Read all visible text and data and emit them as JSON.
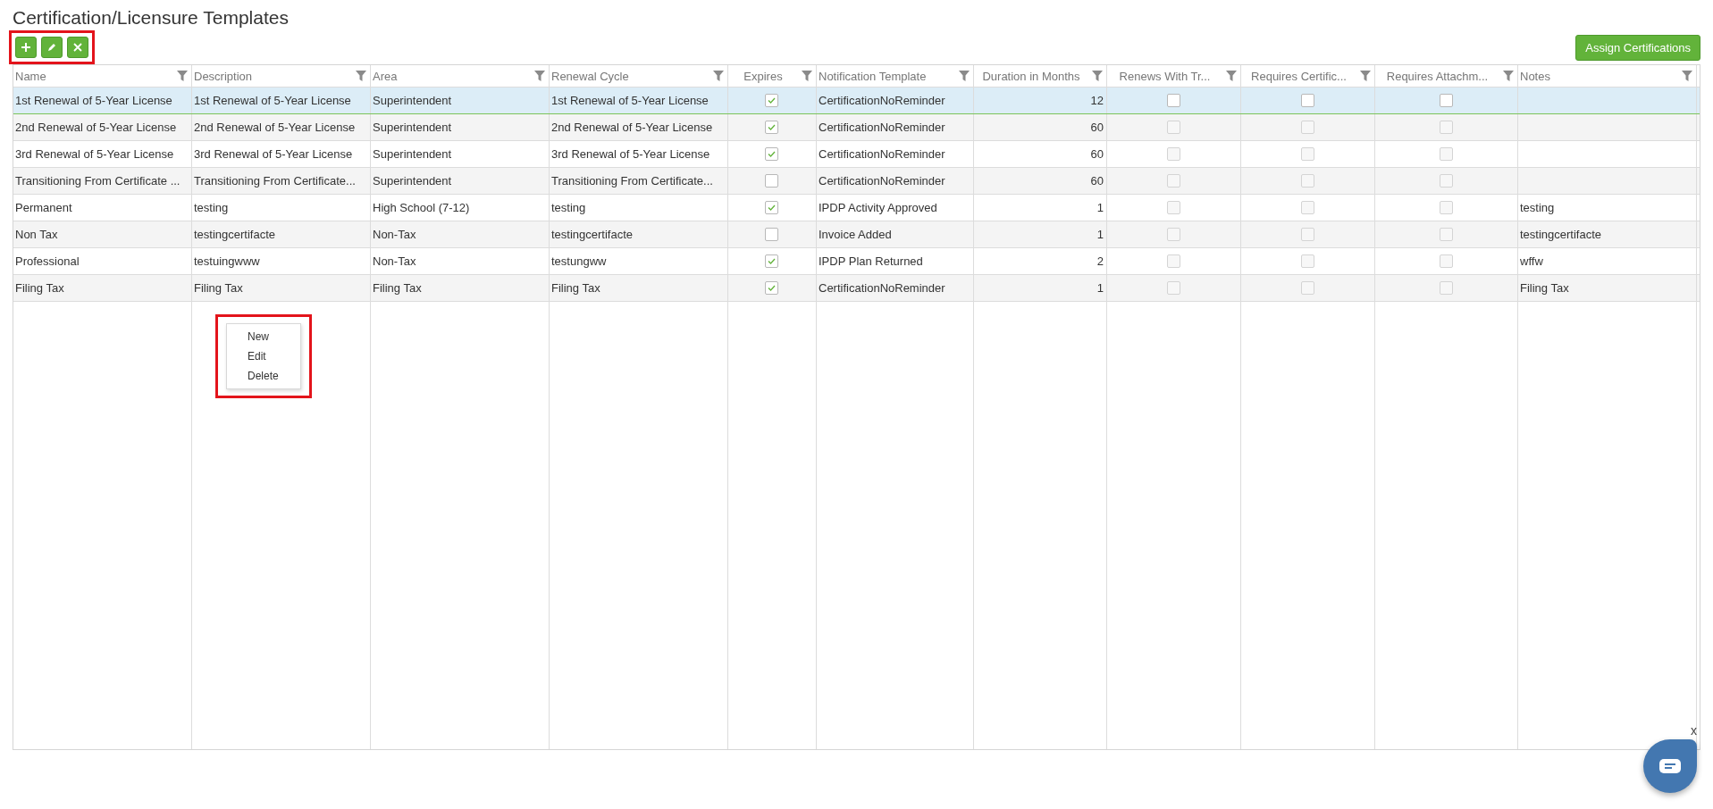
{
  "title": "Certification/Licensure Templates",
  "toolbar": [
    {
      "kind": "add"
    },
    {
      "kind": "edit"
    },
    {
      "kind": "delete"
    }
  ],
  "assign_button": "Assign Certifications",
  "columns": [
    "Name",
    "Description",
    "Area",
    "Renewal Cycle",
    "Expires",
    "Notification Template",
    "Duration in Months",
    "Renews With Tr...",
    "Requires Certific...",
    "Requires Attachm...",
    "Notes"
  ],
  "rows": [
    {
      "selected": true,
      "name": "1st Renewal of 5-Year License",
      "description": "1st Renewal of 5-Year License",
      "area": "Superintendent",
      "renewal_cycle": "1st Renewal of 5-Year License",
      "expires": true,
      "notification": "CertificationNoReminder",
      "duration": "12",
      "renews": false,
      "requires_certificate": false,
      "requires_attachment": false
    },
    {
      "selected": false,
      "name": "2nd Renewal of 5-Year License",
      "description": "2nd Renewal of 5-Year License",
      "area": "Superintendent",
      "renewal_cycle": "2nd Renewal of 5-Year License",
      "expires": true,
      "notification": "CertificationNoReminder",
      "duration": "60",
      "renews": false,
      "requires_certificate": false,
      "requires_attachment": false
    },
    {
      "selected": false,
      "name": "3rd Renewal of 5-Year License",
      "description": "3rd Renewal of 5-Year License",
      "area": "Superintendent",
      "renewal_cycle": "3rd Renewal of 5-Year License",
      "expires": true,
      "notification": "CertificationNoReminder",
      "duration": "60",
      "renews": false,
      "requires_certificate": false,
      "requires_attachment": false
    },
    {
      "selected": false,
      "name": "Transitioning From Certificate ...",
      "description": "Transitioning From Certificate...",
      "area": "Superintendent",
      "renewal_cycle": "Transitioning From Certificate...",
      "expires": false,
      "notification": "CertificationNoReminder",
      "duration": "60",
      "renews": false,
      "requires_certificate": false,
      "requires_attachment": false
    },
    {
      "selected": false,
      "name": "Permanent",
      "description": "testing",
      "area": "High School (7-12)",
      "renewal_cycle": "testing",
      "expires": true,
      "notification": "IPDP Activity Approved",
      "duration": "1",
      "renews": false,
      "requires_certificate": false,
      "requires_attachment": false,
      "notes": "testing"
    },
    {
      "selected": false,
      "name": "Non Tax",
      "description": "testingcertifacte",
      "area": "Non-Tax",
      "renewal_cycle": "testingcertifacte",
      "expires": false,
      "notification": "Invoice Added",
      "duration": "1",
      "renews": false,
      "requires_certificate": false,
      "requires_attachment": false,
      "notes": "testingcertifacte"
    },
    {
      "selected": false,
      "name": "Professional",
      "description": "testuingwww",
      "area": "Non-Tax",
      "renewal_cycle": "testungww",
      "expires": true,
      "notification": "IPDP Plan Returned",
      "duration": "2",
      "renews": false,
      "requires_certificate": false,
      "requires_attachment": false,
      "notes": "wffw"
    },
    {
      "selected": false,
      "name": "Filing Tax",
      "description": "Filing Tax",
      "area": "Filing Tax",
      "renewal_cycle": "Filing Tax",
      "expires": true,
      "notification": "CertificationNoReminder",
      "duration": "1",
      "renews": false,
      "requires_certificate": false,
      "requires_attachment": false,
      "notes": "Filing Tax"
    }
  ],
  "context_menu": [
    "New",
    "Edit",
    "Delete"
  ],
  "chat_close": "x"
}
